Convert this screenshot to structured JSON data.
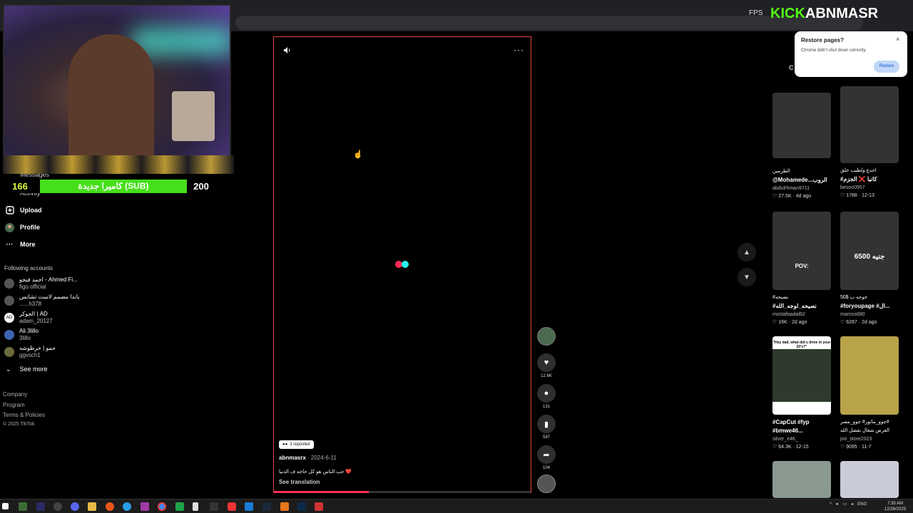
{
  "overlay": {
    "sub_count": "166",
    "sub_label": "كاميرا جديدة (SUB)",
    "sub_goal": "200",
    "kick_prefix": "KICK",
    "kick_channel": "ABNMASR",
    "fps_label": "FPS"
  },
  "restore_popup": {
    "title": "Restore pages?",
    "message": "Chrome didn't shut down correctly.",
    "button": "Restore",
    "close": "×"
  },
  "sidebar": {
    "peek_messages": "Messages",
    "peek_activity": "Activity",
    "items": [
      {
        "label": "Upload",
        "icon": "plus-square-icon"
      },
      {
        "label": "Profile",
        "icon": "profile-avatar-icon"
      },
      {
        "label": "More",
        "icon": "more-dots-icon"
      }
    ],
    "following_title": "Following accounts",
    "following": [
      {
        "name": "احمد فيجو - Ahmed Fi...",
        "handle": "figo.official",
        "avatar": ""
      },
      {
        "name": "باندا مصمم لاست تشانس",
        "handle": "......h378",
        "avatar": ""
      },
      {
        "name": "الجوكر | AD",
        "handle": "adam_20127",
        "avatar": "AD"
      },
      {
        "name": "Ali 3lillo",
        "handle": "3lillo",
        "avatar": ""
      },
      {
        "name": "حمو | خرطوشه",
        "handle": "ggvsch1",
        "avatar": ""
      }
    ],
    "see_more": "See more",
    "footer": [
      "Company",
      "Program",
      "Terms & Policies",
      "© 2025 TikTok"
    ]
  },
  "video": {
    "repost_text": "3 reposted",
    "author": "abnmasrx",
    "date": " · 2024-6-11",
    "caption": "حب الناس هو كل حاجه ف الدنيا ❤️",
    "see_translation": "See translation",
    "progress": 0.37
  },
  "actions": {
    "likes": "12.6K",
    "comments": "131",
    "saves": "587",
    "shares": "104"
  },
  "right_header": "C",
  "grid": [
    {
      "cap": "الطرمين",
      "cap2": "@Mohamede...الروب",
      "user": "abdulrhman9711",
      "likes": "27.5K",
      "date": "4d ago",
      "thumb": "#5a5a5a",
      "overlay": ""
    },
    {
      "cap": "احدع ولطيب حلق",
      "cap2": "#كانيا ❌ الجزم",
      "user": "besoo0957",
      "likes": "1788",
      "date": "12-13",
      "thumb": "#1d1d1d",
      "overlay": ""
    },
    {
      "cap": "#نصيحه",
      "cap2": "#نصيحه_لوجه_الله",
      "user": "mostafaadal62",
      "likes": "16K",
      "date": "2d ago",
      "thumb": "#6d6d6d",
      "overlay": "POV:"
    },
    {
      "cap": "50$ خوجه ب",
      "cap2": "#foryoupage #ال...",
      "user": "maross680",
      "likes": "6287",
      "date": "2d ago",
      "thumb": "#7a2a22",
      "overlay": "6500 جنيه"
    },
    {
      "cap": "#CapCut #fyp",
      "cap2": "#bmwe46...",
      "user": "silver_e46_",
      "likes": "64.3K",
      "date": "12-15",
      "thumb": "#2d3a2d",
      "overlay": "\"Hey dad, what did u drive in your 20's?\""
    },
    {
      "cap": "جوو_ماتور# جوو_مصر#",
      "cap2": "العرض شغال بفضل الله",
      "user": "joo_store2023",
      "likes": "9095",
      "date": "11-7",
      "thumb": "#b8a24a",
      "overlay": ""
    },
    {
      "cap": "",
      "cap2": "",
      "user": "",
      "likes": "",
      "date": "",
      "thumb": "#8a9a90",
      "overlay": ""
    },
    {
      "cap": "",
      "cap2": "",
      "user": "",
      "likes": "",
      "date": "",
      "thumb": "#c9ccd6",
      "overlay": ""
    }
  ],
  "taskbar": {
    "lang": "ENG",
    "time": "7:35 AM",
    "date": "12/26/2025"
  }
}
